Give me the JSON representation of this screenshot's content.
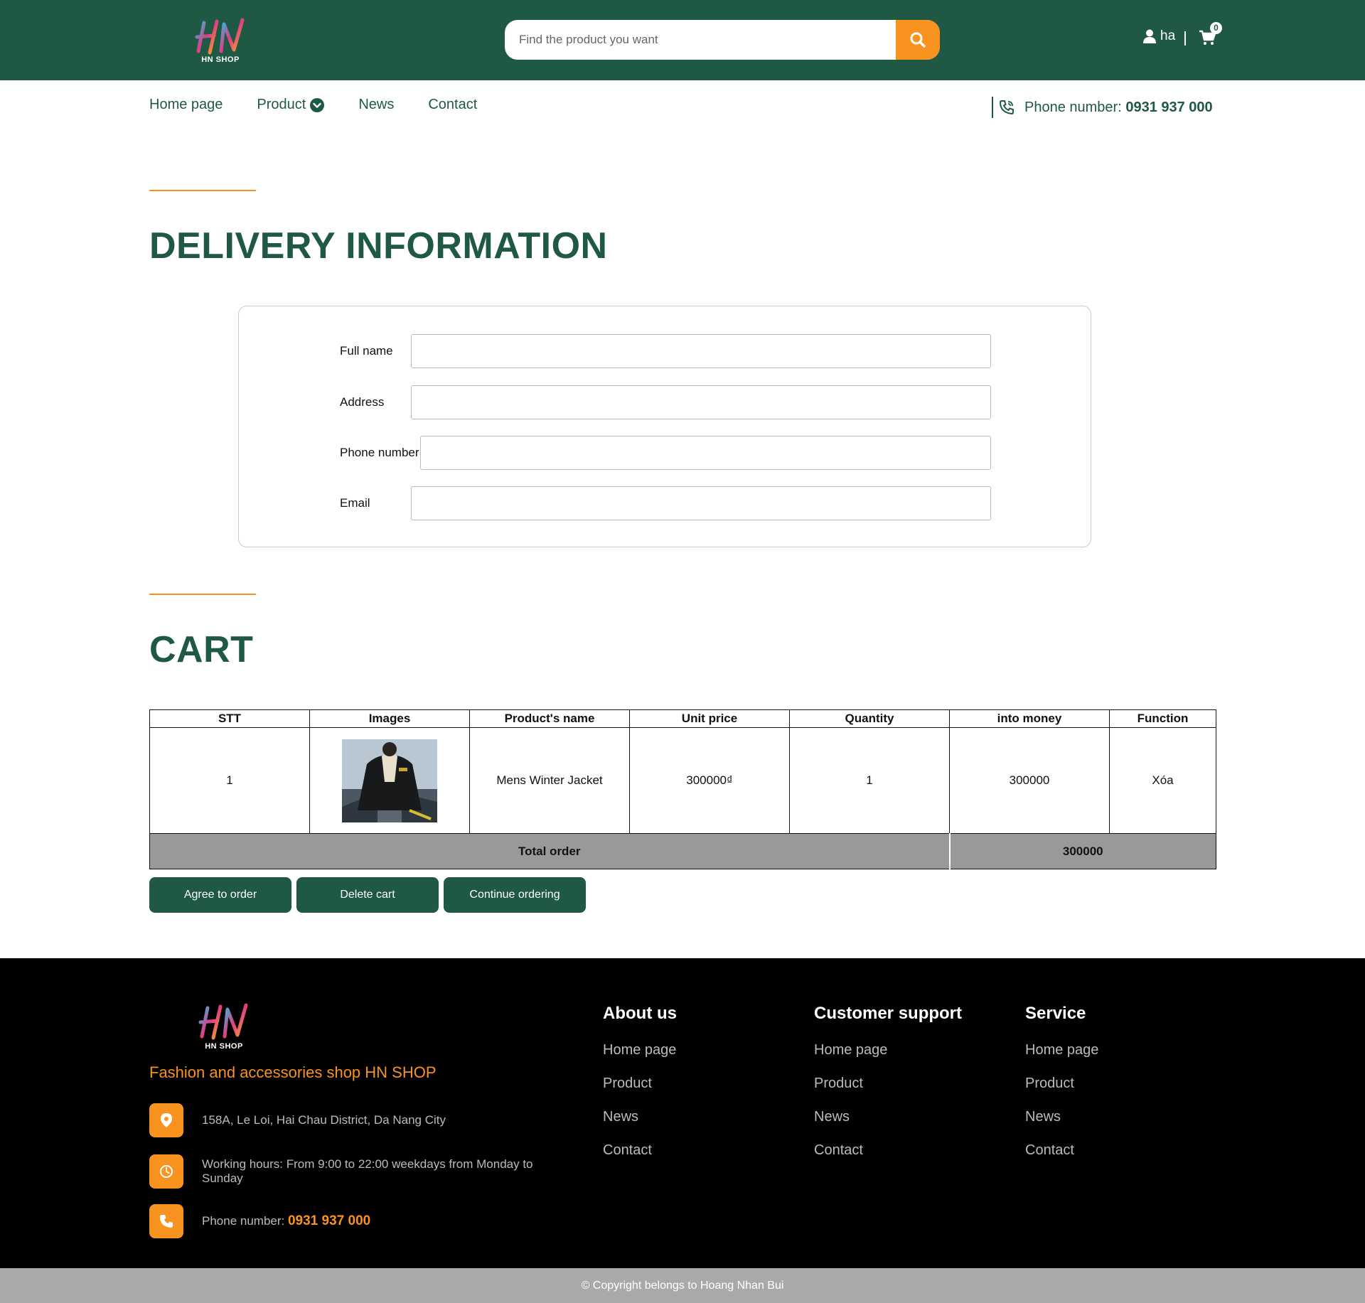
{
  "brand": {
    "logo_text": "HN",
    "shop_label": "HN SHOP"
  },
  "search": {
    "placeholder": "Find the product you want"
  },
  "user": {
    "name": "ha"
  },
  "cart": {
    "count": "0"
  },
  "nav": {
    "items": [
      {
        "label": "Home page"
      },
      {
        "label": "Product"
      },
      {
        "label": "News"
      },
      {
        "label": "Contact"
      }
    ],
    "phone_label": "Phone number:",
    "phone_value": "0931 937 000"
  },
  "delivery": {
    "heading": "DELIVERY INFORMATION",
    "fields": {
      "full_name": {
        "label": "Full name",
        "value": ""
      },
      "address": {
        "label": "Address",
        "value": ""
      },
      "phone": {
        "label": "Phone number",
        "value": ""
      },
      "email": {
        "label": "Email",
        "value": ""
      }
    }
  },
  "cart_section": {
    "heading": "CART",
    "columns": [
      "STT",
      "Images",
      "Product's name",
      "Unit price",
      "Quantity",
      "into money",
      "Function"
    ],
    "rows": [
      {
        "stt": "1",
        "image": "winter-jacket-photo",
        "name": "Mens Winter Jacket",
        "unit_price": "300000₫",
        "quantity": "1",
        "into_money": "300000",
        "function": "Xóa"
      }
    ],
    "total_label": "Total order",
    "total_value": "300000",
    "buttons": {
      "agree": "Agree to order",
      "delete": "Delete cart",
      "continue": "Continue ordering"
    }
  },
  "footer": {
    "logo_text": "HN",
    "shop_label": "HN SHOP",
    "tagline": "Fashion and accessories shop HN SHOP",
    "address": "158A, Le Loi, Hai Chau District, Da Nang City",
    "hours": "Working hours: From 9:00 to 22:00 weekdays from Monday to Sunday",
    "phone_label": "Phone number:",
    "phone_value": "0931 937 000",
    "columns": [
      {
        "title": "About us",
        "links": [
          "Home page",
          "Product",
          "News",
          "Contact"
        ]
      },
      {
        "title": "Customer support",
        "links": [
          "Home page",
          "Product",
          "News",
          "Contact"
        ]
      },
      {
        "title": "Service",
        "links": [
          "Home page",
          "Product",
          "News",
          "Contact"
        ]
      }
    ],
    "copyright": "© Copyright belongs to Hoang Nhan Bui"
  },
  "colors": {
    "brand_green": "#1f5944",
    "accent_orange": "#f7931e",
    "footer_bg": "#000000",
    "copyright_bg": "#a9a9a9"
  }
}
